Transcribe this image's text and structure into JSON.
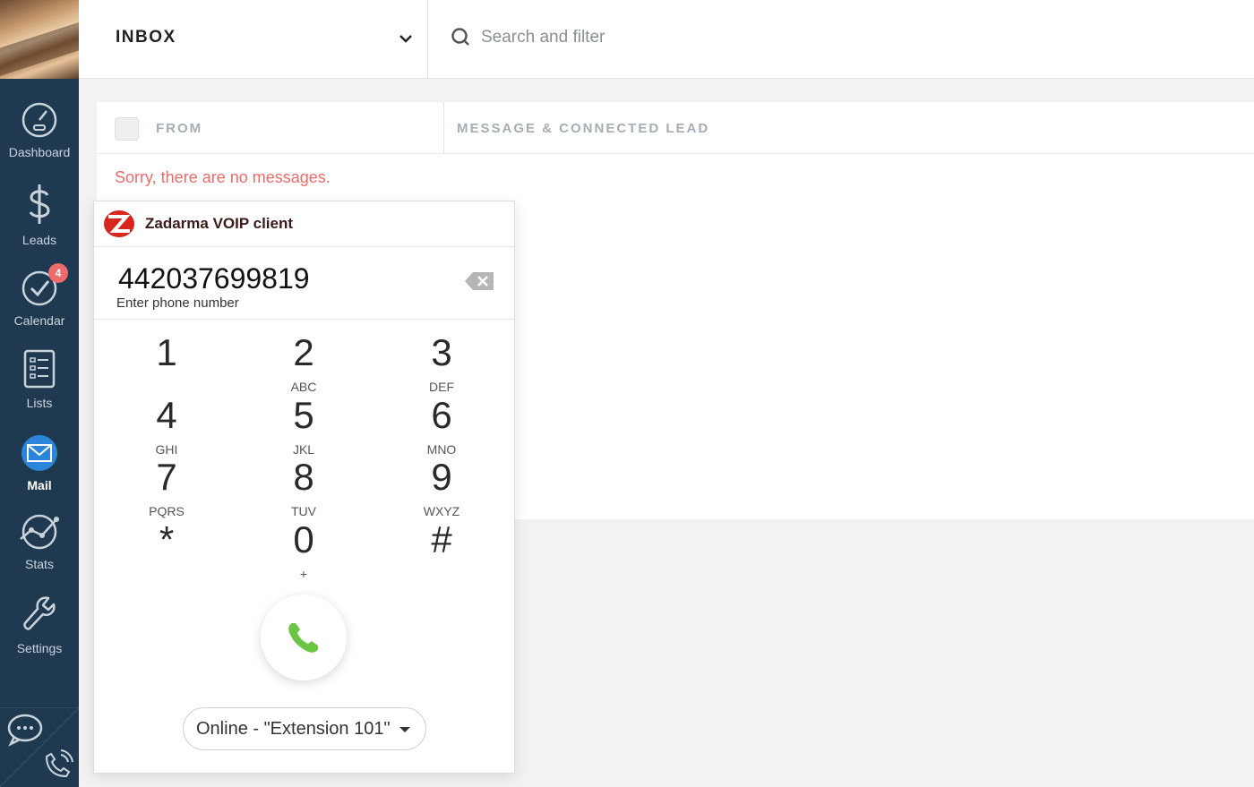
{
  "sidebar": {
    "items": [
      {
        "label": "Dashboard",
        "icon": "speedometer-icon"
      },
      {
        "label": "Leads",
        "icon": "dollar-icon"
      },
      {
        "label": "Calendar",
        "icon": "checkmark-icon",
        "badge": "4"
      },
      {
        "label": "Lists",
        "icon": "list-icon"
      },
      {
        "label": "Mail",
        "icon": "mail-icon",
        "active": true
      },
      {
        "label": "Stats",
        "icon": "stats-icon"
      },
      {
        "label": "Settings",
        "icon": "wrench-icon"
      }
    ]
  },
  "header": {
    "inbox_title": "INBOX",
    "search_placeholder": "Search and filter"
  },
  "table": {
    "columns": [
      "FROM",
      "MESSAGE & CONNECTED LEAD"
    ],
    "empty_message": "Sorry, there are no messages."
  },
  "voip": {
    "title": "Zadarma VOIP client",
    "phone_number": "442037699819",
    "phone_hint": "Enter phone number",
    "keys": [
      {
        "digit": "1",
        "letters": ""
      },
      {
        "digit": "2",
        "letters": "ABC"
      },
      {
        "digit": "3",
        "letters": "DEF"
      },
      {
        "digit": "4",
        "letters": "GHI"
      },
      {
        "digit": "5",
        "letters": "JKL"
      },
      {
        "digit": "6",
        "letters": "MNO"
      },
      {
        "digit": "7",
        "letters": "PQRS"
      },
      {
        "digit": "8",
        "letters": "TUV"
      },
      {
        "digit": "9",
        "letters": "WXYZ"
      },
      {
        "digit": "*",
        "letters": ""
      },
      {
        "digit": "0",
        "letters": "+"
      },
      {
        "digit": "#",
        "letters": ""
      }
    ],
    "status": "Online - \"Extension 101\""
  },
  "colors": {
    "sidebar_bg": "#1f3a50",
    "accent_red": "#ef6b6b",
    "call_green": "#6cc644",
    "mail_blue": "#2b86d9"
  }
}
